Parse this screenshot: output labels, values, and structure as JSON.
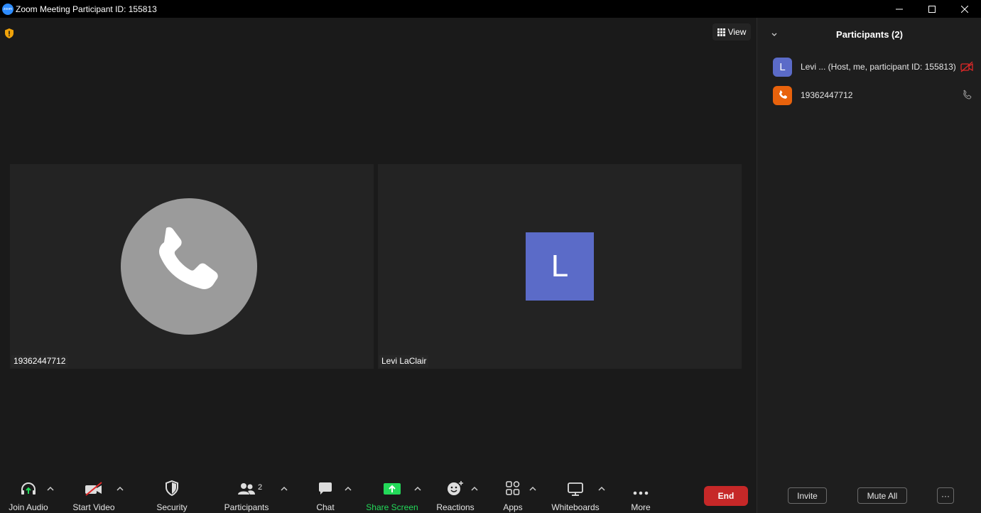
{
  "window": {
    "title": "Zoom Meeting Participant ID: 155813",
    "logo_text": "zoom"
  },
  "meeting": {
    "view_label": "View",
    "tiles": [
      {
        "name": "19362447712",
        "type": "phone"
      },
      {
        "name": "Levi LaClair",
        "type": "avatar",
        "initial": "L",
        "color": "#5b6bc8"
      }
    ]
  },
  "toolbar": {
    "join_audio": "Join Audio",
    "start_video": "Start Video",
    "security": "Security",
    "participants": "Participants",
    "participants_count": "2",
    "chat": "Chat",
    "share_screen": "Share Screen",
    "reactions": "Reactions",
    "apps": "Apps",
    "whiteboards": "Whiteboards",
    "more": "More",
    "end": "End"
  },
  "panel": {
    "title": "Participants (2)",
    "participants": [
      {
        "initial": "L",
        "name": "Levi ... (Host, me, participant ID: 155813)",
        "avatar_color": "#5b6bc8",
        "status": "video-off"
      },
      {
        "name": "19362447712",
        "avatar_color": "#e8620c",
        "status": "phone"
      }
    ],
    "invite": "Invite",
    "mute_all": "Mute All",
    "more_options": "···"
  },
  "colors": {
    "accent_green": "#23d959",
    "end_red": "#c62828",
    "video_off_red": "#e02828"
  }
}
